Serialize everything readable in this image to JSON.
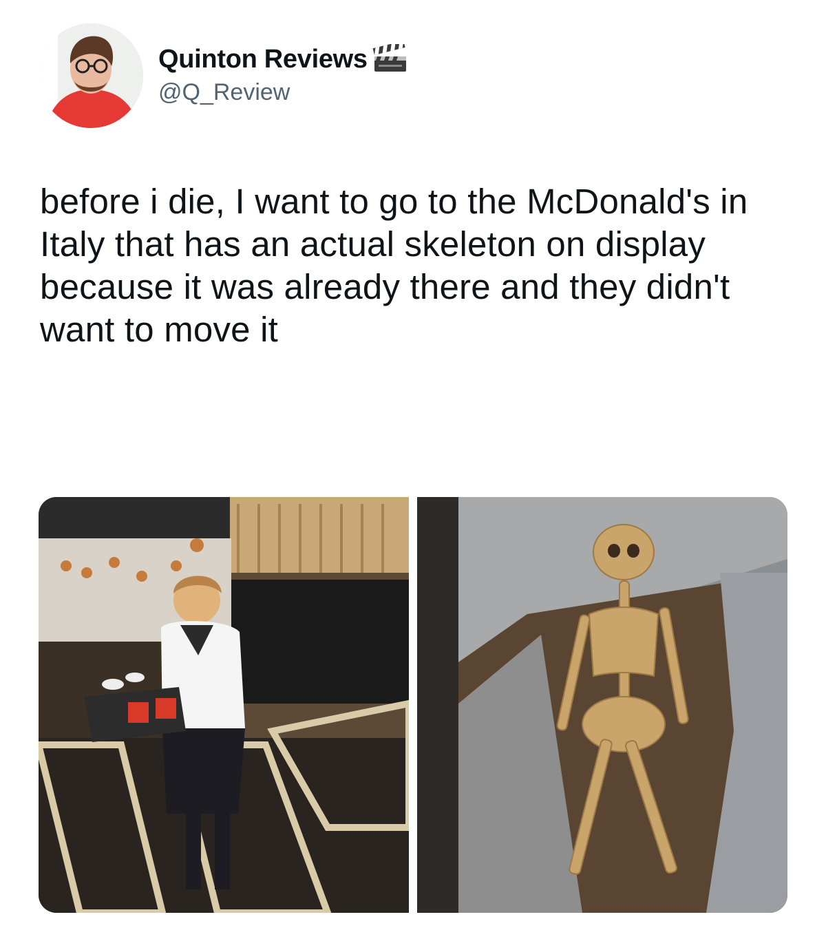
{
  "tweet": {
    "author": {
      "display_name": "Quinton Reviews",
      "handle": "@Q_Review",
      "name_emoji": "clapper-board-icon"
    },
    "text": "before i die, I want to go to the McDonald's in Italy that has an actual skeleton on display because it was already there and they didn't want to move it",
    "media": [
      {
        "description_icon": "photo-mcdonalds-interior"
      },
      {
        "description_icon": "photo-skeleton-in-soil"
      }
    ]
  },
  "colors": {
    "text_primary": "#0f1419",
    "text_secondary": "#536471",
    "background": "#ffffff",
    "avatar_shirt": "#e53935"
  }
}
